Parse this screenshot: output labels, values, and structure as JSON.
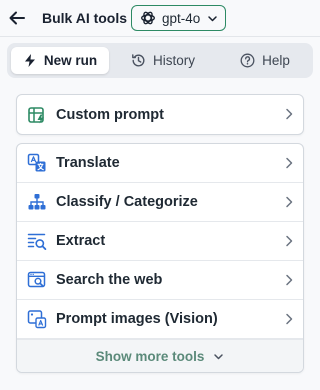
{
  "header": {
    "title": "Bulk AI tools",
    "model": "gpt-4o",
    "back_icon": "arrow-left-icon",
    "model_icon": "openai-logo-icon"
  },
  "tabs": [
    {
      "label": "New run",
      "icon": "bolt-icon",
      "active": true
    },
    {
      "label": "History",
      "icon": "history-icon",
      "active": false
    },
    {
      "label": "Help",
      "icon": "help-circle-icon",
      "active": false
    }
  ],
  "custom": {
    "label": "Custom prompt",
    "icon": "spreadsheet-magic-icon"
  },
  "tools": [
    {
      "label": "Translate",
      "icon": "translate-icon"
    },
    {
      "label": "Classify / Categorize",
      "icon": "hierarchy-icon"
    },
    {
      "label": "Extract",
      "icon": "extract-search-icon"
    },
    {
      "label": "Search the web",
      "icon": "web-search-icon"
    },
    {
      "label": "Prompt images (Vision)",
      "icon": "image-prompt-icon"
    }
  ],
  "show_more_label": "Show more tools",
  "colors": {
    "accent_green": "#2d8a64",
    "icon_blue": "#2f6fd6",
    "muted_green_text": "#5b8a7a"
  }
}
